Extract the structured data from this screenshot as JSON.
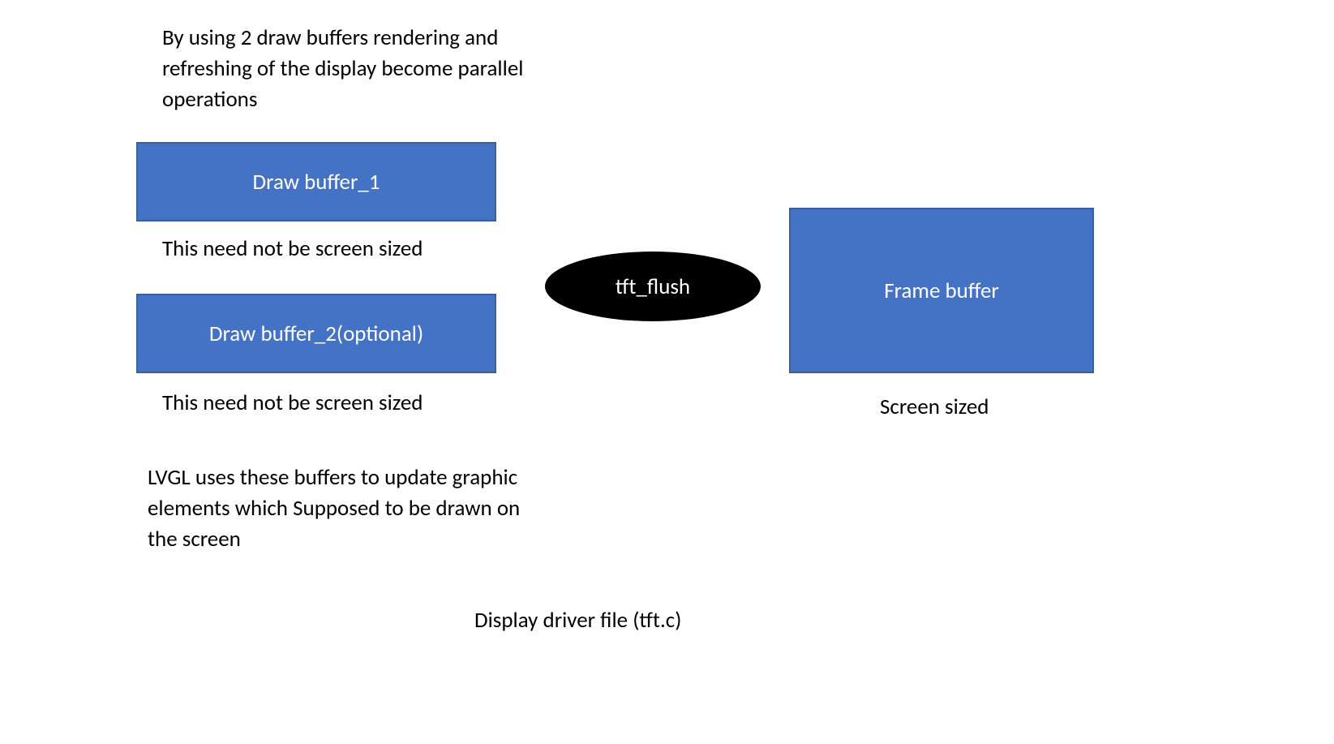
{
  "topText": "By using 2 draw buffers rendering and refreshing of the display become parallel operations",
  "drawBuffer1": {
    "label": "Draw buffer_1",
    "caption": "This need not be screen sized"
  },
  "drawBuffer2": {
    "label": "Draw buffer_2(optional)",
    "caption": "This need not be screen sized"
  },
  "tftFlush": {
    "label": "tft_flush"
  },
  "frameBuffer": {
    "label": "Frame buffer",
    "caption": "Screen sized"
  },
  "lvglText": "LVGL uses these buffers to update graphic elements which Supposed to be drawn on the screen",
  "footerText": "Display driver file (tft.c)"
}
